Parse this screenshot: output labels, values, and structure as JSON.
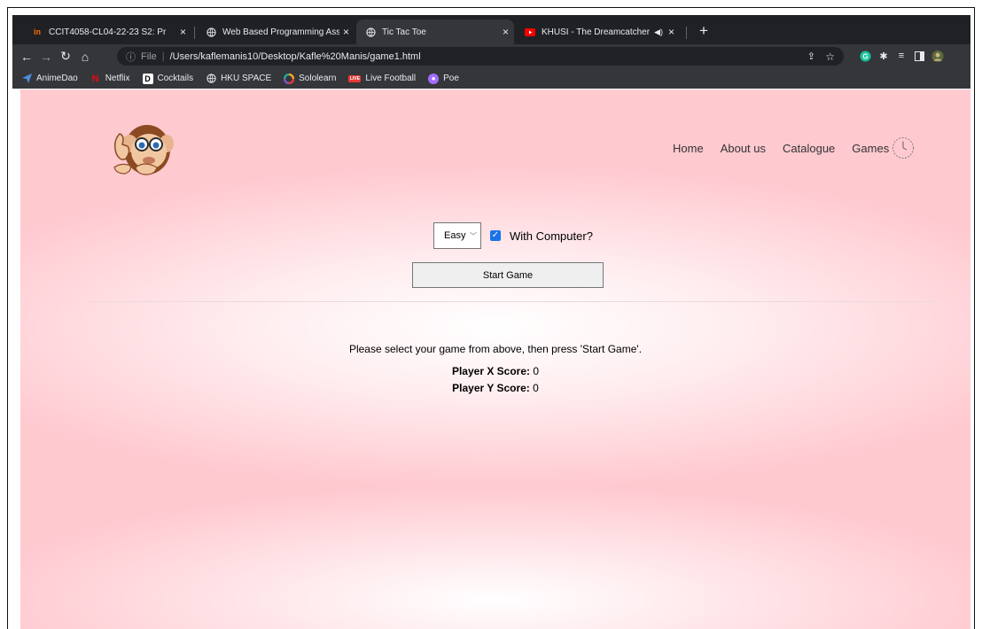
{
  "browser": {
    "tabs": [
      {
        "title": "CCIT4058-CL04-22-23 S2: Pr",
        "favicon": "in",
        "active": false
      },
      {
        "title": "Web Based Programming Assig",
        "favicon": "globe",
        "active": false
      },
      {
        "title": "Tic Tac Toe",
        "favicon": "globe",
        "active": true
      },
      {
        "title": "KHUSI - The Dreamcatcher",
        "favicon": "youtube",
        "active": false
      }
    ],
    "url_scheme_label": "File",
    "url": "/Users/kaflemanis10/Desktop/Kafle%20Manis/game1.html",
    "bookmarks": [
      {
        "label": "AnimeDao",
        "icon": "send-icon",
        "color": "#4a90e2"
      },
      {
        "label": "Netflix",
        "icon": "netflix-icon",
        "color": "#e50914"
      },
      {
        "label": "Cocktails",
        "icon": "d-icon",
        "color": "#ffffff"
      },
      {
        "label": "HKU SPACE",
        "icon": "globe-icon",
        "color": "#e8eaed"
      },
      {
        "label": "Sololearn",
        "icon": "sololearn-icon",
        "color": "#f9a825"
      },
      {
        "label": "Live Football",
        "icon": "live-icon",
        "color": "#e53935"
      },
      {
        "label": "Poe",
        "icon": "poe-icon",
        "color": "#a36bff"
      }
    ]
  },
  "site": {
    "nav": [
      "Home",
      "About us",
      "Catalogue",
      "Games"
    ]
  },
  "game": {
    "difficulty": "Easy",
    "with_computer_label": "With Computer?",
    "with_computer_checked": true,
    "start_label": "Start Game",
    "message": "Please select your game from above, then press 'Start Game'.",
    "player_x_label": "Player X Score:",
    "player_x_score": "0",
    "player_y_label": "Player Y Score:",
    "player_y_score": "0"
  },
  "colors": {
    "page_bg": "#ffc9d0",
    "accent_checkbox": "#1a73e8"
  }
}
